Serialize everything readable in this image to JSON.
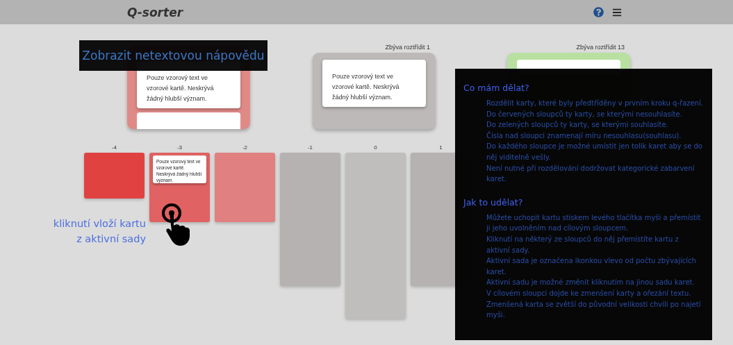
{
  "header": {
    "title": "Q-sorter"
  },
  "decks": [
    {
      "color": "#e08a88",
      "cards": [
        "Pouze vzorový text ve vzorové kartě. Neskrývá žádný hlubší význam."
      ],
      "stacked": true
    },
    {
      "label": "Zbýva roztřídit 1",
      "color": "#bcb9b8",
      "cards": [
        "Pouze vzorový text ve vzorové kartě. Neskrývá žádný hlubší význam."
      ],
      "stacked": false
    },
    {
      "label": "Zbýva roztřídit 13",
      "color": "#b9e0a0",
      "stacked": false
    }
  ],
  "columns": [
    {
      "label": "-4",
      "color": "#e04242",
      "kind": "short"
    },
    {
      "label": "-3",
      "color": "#e06262",
      "kind": "medium",
      "cards": [
        "Pouze vzorový text ve vzorové kartě. Neskrývá žádný hlubší význam."
      ]
    },
    {
      "label": "-2",
      "color": "#e08080",
      "kind": "medium"
    },
    {
      "label": "-1",
      "color": "#b5b2b1",
      "kind": "tall"
    },
    {
      "label": "0",
      "color": "#bfbebd",
      "kind": "tallest"
    },
    {
      "label": "1",
      "color": "#b5b2b1",
      "kind": "tall"
    }
  ],
  "tooltip": {
    "text": "Zobrazit netextovou nápovědu"
  },
  "click_hint": {
    "lines": [
      "kliknutí vloží kartu",
      "z aktivní sady"
    ]
  },
  "help": {
    "sections": [
      {
        "heading": "Co mám dělat?",
        "paragraphs": [
          "Rozdělit karty, které byly předtříděny v prvním kroku q-řazení.",
          "Do červených sloupců ty karty, se kterými nesouhlasíte.",
          "Do zelených sloupců ty karty, se kterými souhlasíte.",
          "Čísla nad sloupci znamenají míru nesouhlasu(souhlasu).",
          "Do každého sloupce je možné umístit jen tolik karet aby se do něj viditelně vešly.",
          "Není nutné při rozdělování dodržovat kategorické zabarvení karet."
        ]
      },
      {
        "heading": "Jak to udělat?",
        "paragraphs": [
          "Můžete uchopit kartu stiskem levého tlačítka myši a přemístit ji jeho uvolněním nad cílovým sloupcem.",
          "Kliknutí na některý ze sloupců do něj přemístíte kartu z aktivní sady.",
          "Aktivní sada je označena ikonkou vlevo od počtu zbývajících karet.",
          "Aktivní sadu je možné změnit kliknutím na jinou sadu karet.",
          "V cílovém sloupci dojde ke zmenšení karty a ořezání textu.",
          "Zmenšená karta se zvětší do původní velikosti chvíli po najetí myši."
        ]
      }
    ]
  }
}
